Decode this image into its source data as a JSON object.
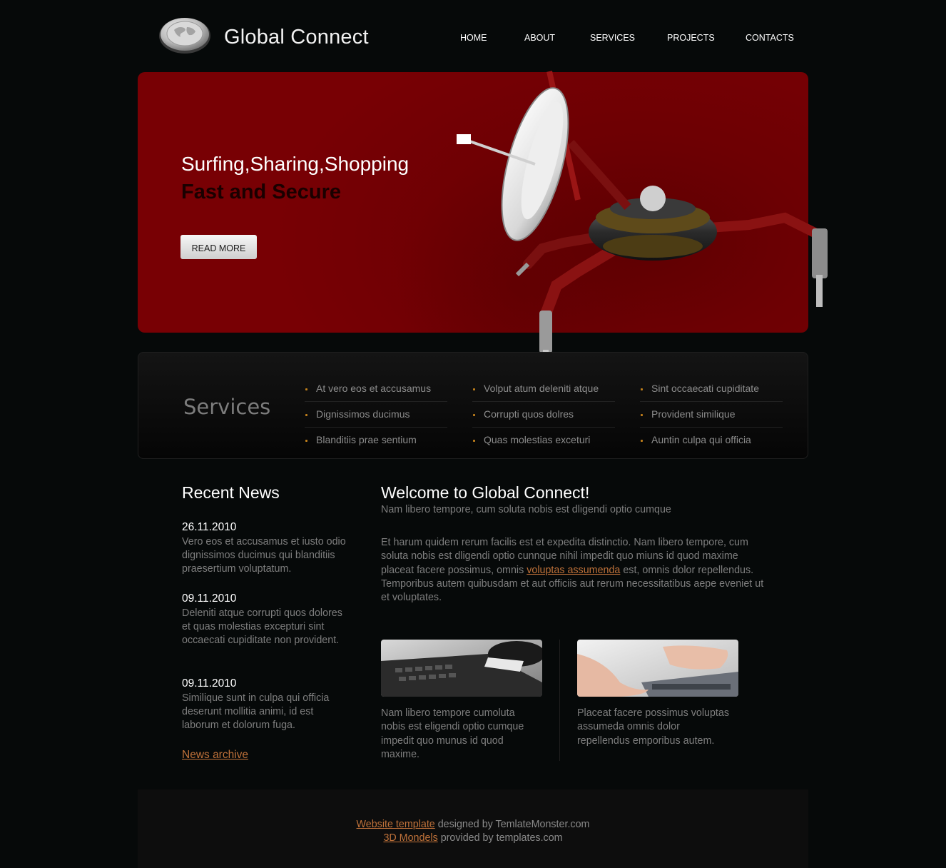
{
  "header": {
    "logo_text": "Global Connect",
    "nav": [
      "HOME",
      "ABOUT",
      "SERVICES",
      "PROJECTS",
      "CONTACTS"
    ]
  },
  "hero": {
    "title_line1": "Surfing,Sharing,Shopping",
    "title_line2": "Fast and Secure",
    "button_label": "READ MORE"
  },
  "services": {
    "title": "Services",
    "columns": [
      [
        "At vero eos et accusamus",
        "Dignissimos ducimus",
        "Blanditiis prae sentium"
      ],
      [
        "Volput atum deleniti atque",
        "Corrupti quos dolres",
        "Quas molestias exceturi"
      ],
      [
        "Sint occaecati cupiditate",
        "Provident similique",
        "Auntin culpa qui officia"
      ]
    ]
  },
  "news": {
    "title": "Recent News",
    "items": [
      {
        "date": "26.11.2010",
        "text": "Vero eos et accusamus et iusto odio dignissimos ducimus qui blanditiis praesertium voluptatum."
      },
      {
        "date": "09.11.2010",
        "text": "Deleniti atque corrupti quos dolores et quas molestias excepturi sint occaecati cupiditate non provident."
      },
      {
        "date": "09.11.2010",
        "text": "Similique sunt in culpa qui officia deserunt mollitia animi, id est laborum et dolorum fuga."
      }
    ],
    "archive_link": "News archive"
  },
  "welcome": {
    "title": "Welcome to Global Connect!",
    "subtitle": "Nam libero tempore, cum soluta nobis est dligendi optio cumque",
    "body_before": "Et harum quidem rerum facilis est et expedita distinctio. Nam libero tempore, cum soluta nobis est dligendi optio cunnque nihil impedit quo miuns id quod maxime placeat facere possimus, omnis ",
    "body_link": "voluptas assumenda",
    "body_after": " est, omnis dolor repellendus. Temporibus autem quibusdam et aut officiis aut rerum necessitatibus aepe eveniet ut et voluptates.",
    "cards": [
      {
        "text": "Nam libero tempore cumoluta nobis est eligendi optio cumque impedit quo munus id quod maxime."
      },
      {
        "text": "Placeat facere possimus voluptas assumeda omnis dolor repellendus emporibus autem."
      }
    ]
  },
  "footer": {
    "line1_link": "Website template",
    "line1_text": " designed by TemlateMonster.com",
    "line2_link": "3D Mondels",
    "line2_text": " provided by templates.com"
  },
  "colors": {
    "background": "#060909",
    "hero_red": "#780004",
    "link": "#c0723a",
    "bullet": "#c07f1b"
  },
  "icons": [
    "globe-logo-icon",
    "bullet-icon"
  ]
}
